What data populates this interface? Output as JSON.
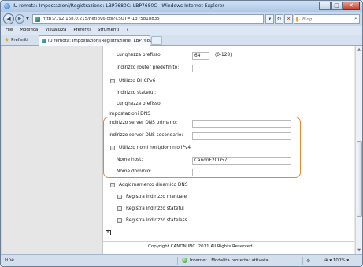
{
  "window": {
    "title": "IU remota: Impostazioni/Registrazione: LBP7680C: LBP7680C - Windows Internet Explorer",
    "btn_minimize": "–",
    "btn_maximize": "□",
    "btn_close": "✕"
  },
  "navbar": {
    "back": "◀",
    "forward": "▶",
    "url": "http://192.168.0.215/netipv6.cgi?CSUT=-1375818835",
    "search_placeholder": "Bing",
    "compat_icon": "▾",
    "refresh_icon": "↻",
    "stop_icon": "✕",
    "search_icon": "⌕"
  },
  "menubar": {
    "items": [
      "File",
      "Modifica",
      "Visualizza",
      "Preferiti",
      "Strumenti",
      "?"
    ]
  },
  "tabbar": {
    "favorites_label": "Preferiti",
    "tab_label": "IU remota: Impostazioni/Registrazione: LBP7680C..."
  },
  "form": {
    "prefix_length_label": "Lunghezza prefisso:",
    "prefix_length_value": "64",
    "prefix_length_hint": "(0-128)",
    "default_router_label": "Indirizzo router predefinito:",
    "default_router_value": "",
    "use_dhcpv6_label": "Utilizzo DHCPv6",
    "stateful_address_label": "Indirizzo stateful:",
    "prefix_length2_label": "Lunghezza prefisso:",
    "dns_section_title": "Impostazioni DNS",
    "dns_primary_label": "Indirizzo server DNS primario:",
    "dns_primary_value": "",
    "dns_secondary_label": "Indirizzo server DNS secondario:",
    "dns_secondary_value": "",
    "use_hostname_ipv4_label": "Utilizzo nomi host/dominio IPv4",
    "host_name_label": "Nome host:",
    "host_name_value": "CanonF2CD57",
    "domain_name_label": "Nome dominio:",
    "domain_name_value": "",
    "dynamic_dns_label": "Aggiornamento dinamico DNS",
    "register_manual_label": "Registra indirizzo manuale",
    "register_stateful_label": "Registra indirizzo stateful",
    "register_stateless_label": "Registra indirizzo stateless"
  },
  "footer": {
    "back_to_top": "≡",
    "copyright": "Copyright CANON INC. 2011 All Rights Reserved"
  },
  "statusbar": {
    "status": "Fine",
    "zone": "Internet | Modalità protetta: attivata",
    "security_icon": "⚙",
    "zoom": "100%"
  },
  "colors": {
    "highlight": "#e8872a",
    "chrome": "#c9d8ea"
  }
}
